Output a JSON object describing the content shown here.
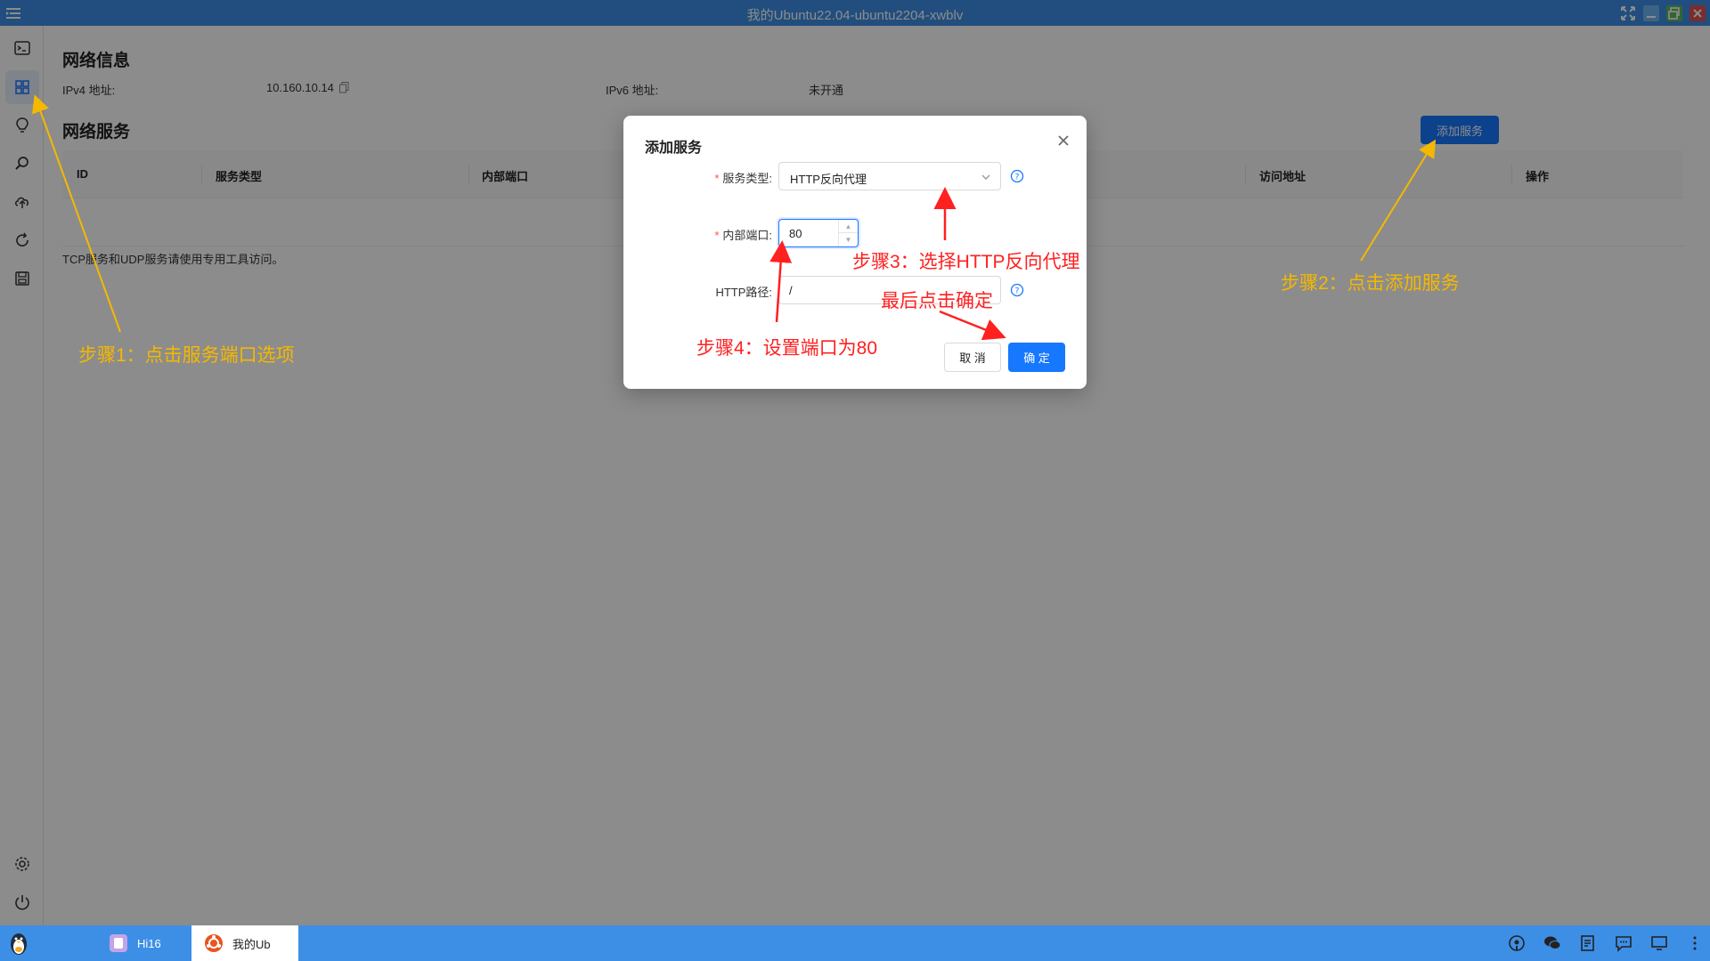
{
  "window": {
    "title": "我的Ubuntu22.04-ubuntu2204-xwblv"
  },
  "network_info": {
    "heading": "网络信息",
    "ipv4_label": "IPv4 地址:",
    "ipv4_value": "10.160.10.14",
    "ipv6_label": "IPv6 地址:",
    "ipv6_value": "未开通"
  },
  "network_services": {
    "heading": "网络服务",
    "add_button": "添加服务",
    "columns": [
      "ID",
      "服务类型",
      "内部端口",
      "访问地址",
      "操作"
    ],
    "note": "TCP服务和UDP服务请使用专用工具访问。"
  },
  "dialog": {
    "title": "添加服务",
    "service_type_label": "服务类型:",
    "service_type_value": "HTTP反向代理",
    "internal_port_label": "内部端口:",
    "internal_port_value": "80",
    "http_path_label": "HTTP路径:",
    "http_path_value": "/",
    "cancel": "取 消",
    "ok": "确 定"
  },
  "annotations": {
    "step1": "步骤1：点击服务端口选项",
    "step2": "步骤2：点击添加服务",
    "step3": "步骤3：选择HTTP反向代理",
    "step4": "步骤4：设置端口为80",
    "final": "最后点击确定"
  },
  "taskbar": {
    "items": [
      {
        "label": "Hi16"
      },
      {
        "label": "我的Ub"
      }
    ]
  },
  "colors": {
    "accent": "#1677ff",
    "titlebar": "#3d8fe6",
    "annotation_yellow": "#f5b800",
    "annotation_red": "#ff2020"
  },
  "icons": {
    "sidebar": [
      "terminal-icon",
      "apps-grid-icon",
      "lightbulb-icon",
      "search-icon",
      "cloud-upload-icon",
      "refresh-icon",
      "save-icon",
      "settings-icon",
      "power-icon"
    ],
    "tray": [
      "podcast-icon",
      "wechat-icon",
      "document-icon",
      "chat-icon",
      "monitor-icon",
      "more-icon"
    ]
  }
}
